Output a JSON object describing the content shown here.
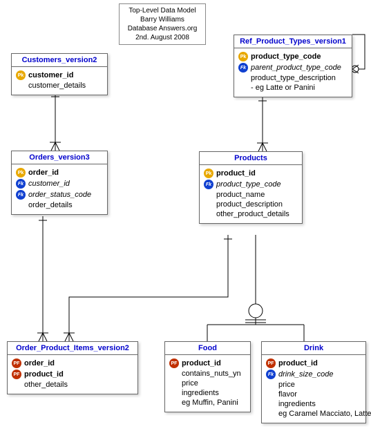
{
  "note": {
    "line1": "Top-Level Data Model",
    "line2": "Barry Williams",
    "line3": "Database Answers.org",
    "line4": "2nd. August 2008"
  },
  "entities": {
    "ref_product_types": {
      "title": "Ref_Product_Types_version1",
      "attrs": [
        {
          "key": "Pk",
          "keyClass": "pk",
          "label": "product_type_code",
          "bold": true
        },
        {
          "key": "Fk",
          "keyClass": "fk",
          "label": "parent_product_type_code",
          "italic": true
        },
        {
          "key": "",
          "label": "product_type_description"
        },
        {
          "key": "",
          "label": "- eg Latte or Panini"
        }
      ]
    },
    "customers": {
      "title": "Customers_version2",
      "attrs": [
        {
          "key": "Pk",
          "keyClass": "pk",
          "label": "customer_id",
          "bold": true
        },
        {
          "key": "",
          "label": "customer_details"
        }
      ]
    },
    "orders": {
      "title": "Orders_version3",
      "attrs": [
        {
          "key": "Pk",
          "keyClass": "pk",
          "label": "order_id",
          "bold": true
        },
        {
          "key": "Fk",
          "keyClass": "fk",
          "label": "customer_id",
          "italic": true
        },
        {
          "key": "Fk",
          "keyClass": "fk",
          "label": "order_status_code",
          "italic": true
        },
        {
          "key": "",
          "label": "order_details"
        }
      ]
    },
    "products": {
      "title": "Products",
      "attrs": [
        {
          "key": "Pk",
          "keyClass": "pk",
          "label": "product_id",
          "bold": true
        },
        {
          "key": "Fk",
          "keyClass": "fk",
          "label": "product_type_code",
          "italic": true
        },
        {
          "key": "",
          "label": "product_name"
        },
        {
          "key": "",
          "label": "product_description"
        },
        {
          "key": "",
          "label": "other_product_details"
        }
      ]
    },
    "order_product_items": {
      "title": "Order_Product_Items_version2",
      "attrs": [
        {
          "key": "PF",
          "keyClass": "pf",
          "label": "order_id",
          "bold": true
        },
        {
          "key": "PF",
          "keyClass": "pf",
          "label": "product_id",
          "bold": true
        },
        {
          "key": "",
          "label": "other_details"
        }
      ]
    },
    "food": {
      "title": "Food",
      "attrs": [
        {
          "key": "PF",
          "keyClass": "pf",
          "label": "product_id",
          "bold": true
        },
        {
          "key": "",
          "label": "contains_nuts_yn"
        },
        {
          "key": "",
          "label": "price"
        },
        {
          "key": "",
          "label": "ingredients"
        },
        {
          "key": "",
          "label": "eg Muffin, Panini"
        }
      ]
    },
    "drink": {
      "title": "Drink",
      "attrs": [
        {
          "key": "PF",
          "keyClass": "pf",
          "label": "product_id",
          "bold": true
        },
        {
          "key": "Fk",
          "keyClass": "fk",
          "label": "drink_size_code",
          "italic": true
        },
        {
          "key": "",
          "label": "price"
        },
        {
          "key": "",
          "label": "flavor"
        },
        {
          "key": "",
          "label": "ingredients"
        },
        {
          "key": "",
          "label": "eg Caramel Macciato, Latte"
        }
      ]
    }
  }
}
